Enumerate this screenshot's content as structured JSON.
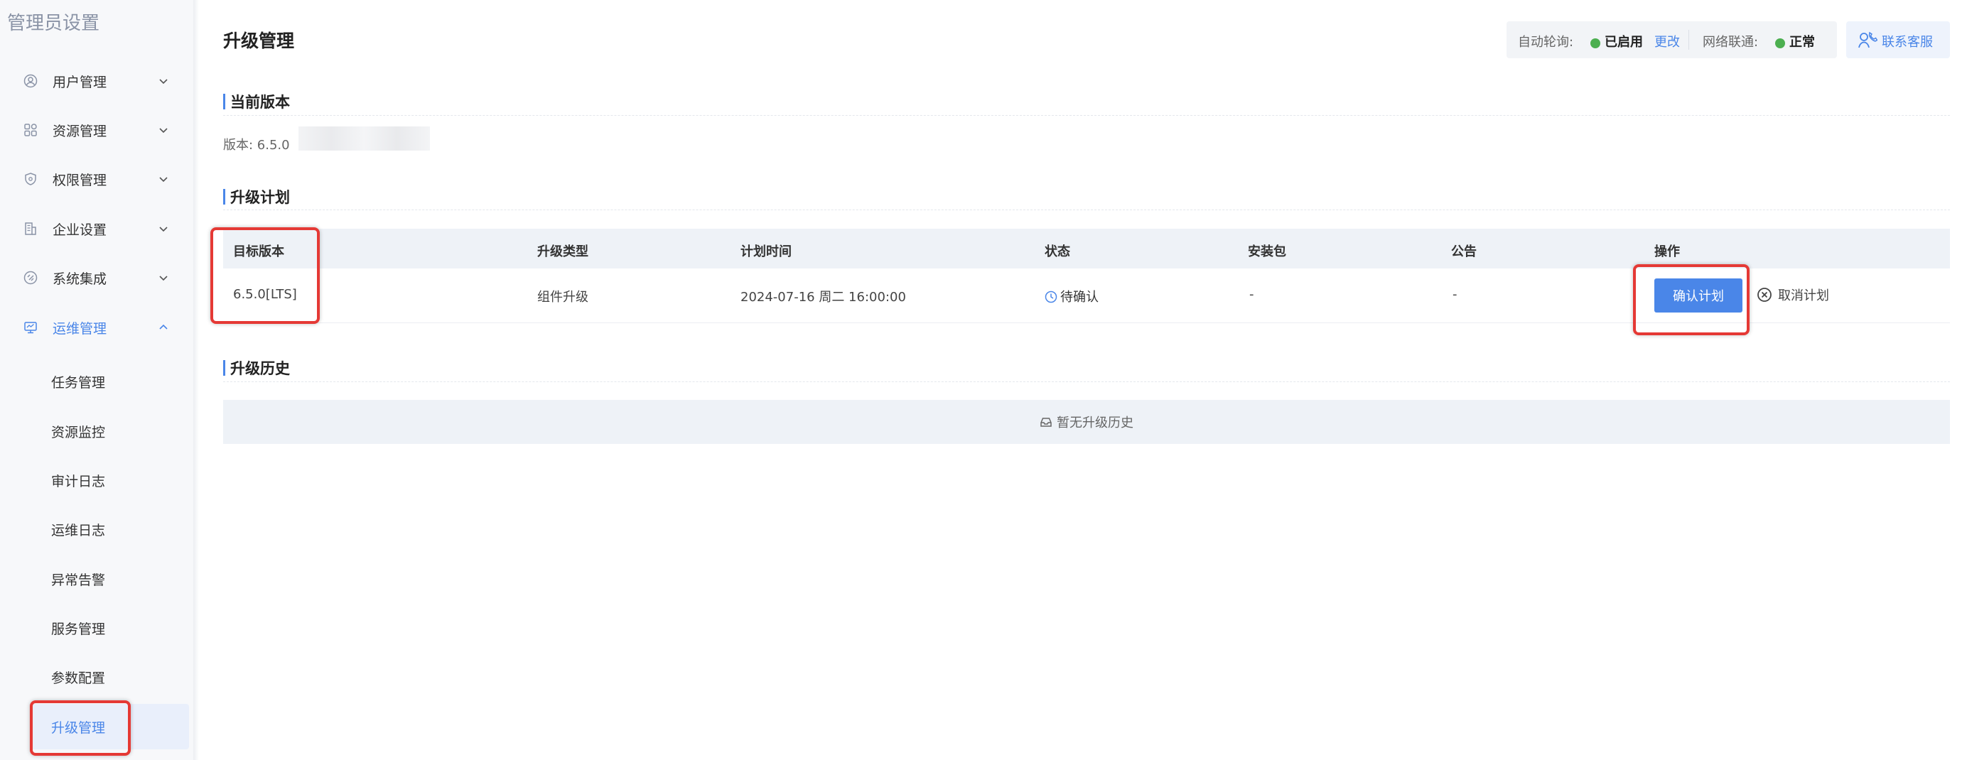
{
  "sidebar": {
    "title": "管理员设置",
    "groups": [
      {
        "label": "用户管理",
        "icon": "user-circle-icon"
      },
      {
        "label": "资源管理",
        "icon": "grid-icon"
      },
      {
        "label": "权限管理",
        "icon": "shield-icon"
      },
      {
        "label": "企业设置",
        "icon": "building-icon"
      },
      {
        "label": "系统集成",
        "icon": "integration-icon"
      },
      {
        "label": "运维管理",
        "icon": "monitor-icon",
        "expanded": true
      }
    ],
    "sub_items": [
      {
        "label": "任务管理"
      },
      {
        "label": "资源监控"
      },
      {
        "label": "审计日志"
      },
      {
        "label": "运维日志"
      },
      {
        "label": "异常告警"
      },
      {
        "label": "服务管理"
      },
      {
        "label": "参数配置"
      },
      {
        "label": "升级管理",
        "active": true
      }
    ]
  },
  "header": {
    "title": "升级管理",
    "auto_poll_label": "自动轮询:",
    "auto_poll_status": "已启用",
    "change_link": "更改",
    "network_label": "网络联通:",
    "network_status": "正常",
    "contact_label": "联系客服"
  },
  "current_version": {
    "section_title": "当前版本",
    "text": "版本: 6.5.0"
  },
  "upgrade_plan": {
    "section_title": "升级计划",
    "columns": [
      "目标版本",
      "升级类型",
      "计划时间",
      "状态",
      "安装包",
      "公告",
      "操作"
    ],
    "rows": [
      {
        "target_version": "6.5.0[LTS]",
        "upgrade_type": "组件升级",
        "plan_time": "2024-07-16 周二 16:00:00",
        "status": "待确认",
        "package": "-",
        "notice": "-",
        "confirm_label": "确认计划",
        "cancel_label": "取消计划"
      }
    ]
  },
  "upgrade_history": {
    "section_title": "升级历史",
    "empty_text": "暂无升级历史"
  },
  "colors": {
    "accent": "#4a86e8",
    "status_ok": "#4caf50",
    "highlight": "#e53935"
  }
}
